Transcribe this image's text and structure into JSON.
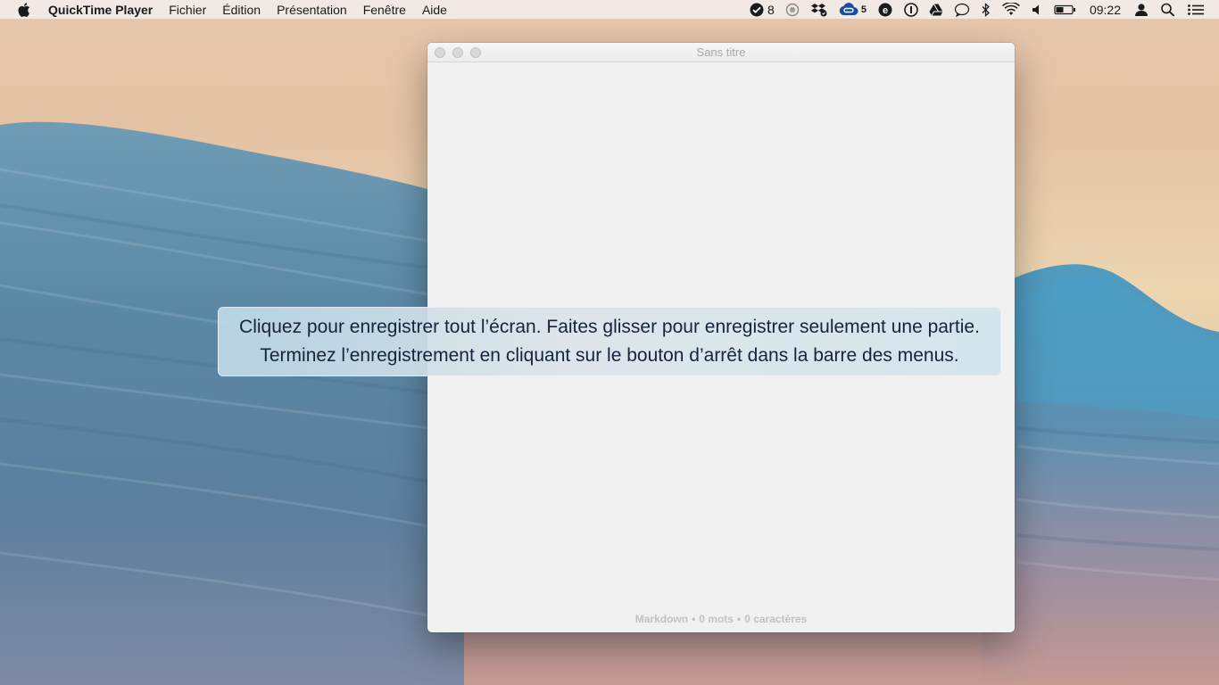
{
  "menubar": {
    "app_name": "QuickTime Player",
    "menus": [
      "Fichier",
      "Édition",
      "Présentation",
      "Fenêtre",
      "Aide"
    ],
    "tray": {
      "mail_count": "8",
      "cloud_count": "5",
      "clock": "09:22"
    }
  },
  "window": {
    "title": "Sans titre",
    "status": {
      "mode": "Markdown",
      "words": "0 mots",
      "chars": "0 caractères",
      "separator": "•"
    }
  },
  "recording_hint": {
    "line1": "Cliquez pour enregistrer tout l’écran. Faites glisser pour enregistrer seulement une partie.",
    "line2": "Terminez l’enregistrement en cliquant sur le bouton d’arrêt dans la barre des menus."
  },
  "icons": {
    "apple": "apple-icon",
    "mail": "mail-badge-icon",
    "record": "record-icon",
    "dropbox": "dropbox-icon",
    "creative_cloud": "creative-cloud-icon",
    "evernote": "evernote-icon",
    "onepassword": "onepassword-icon",
    "drive": "google-drive-icon",
    "messages": "messages-icon",
    "bluetooth": "bluetooth-icon",
    "wifi": "wifi-icon",
    "volume": "volume-icon",
    "battery": "battery-icon",
    "user": "user-icon",
    "spotlight": "spotlight-search-icon",
    "notifications": "notification-center-icon"
  }
}
